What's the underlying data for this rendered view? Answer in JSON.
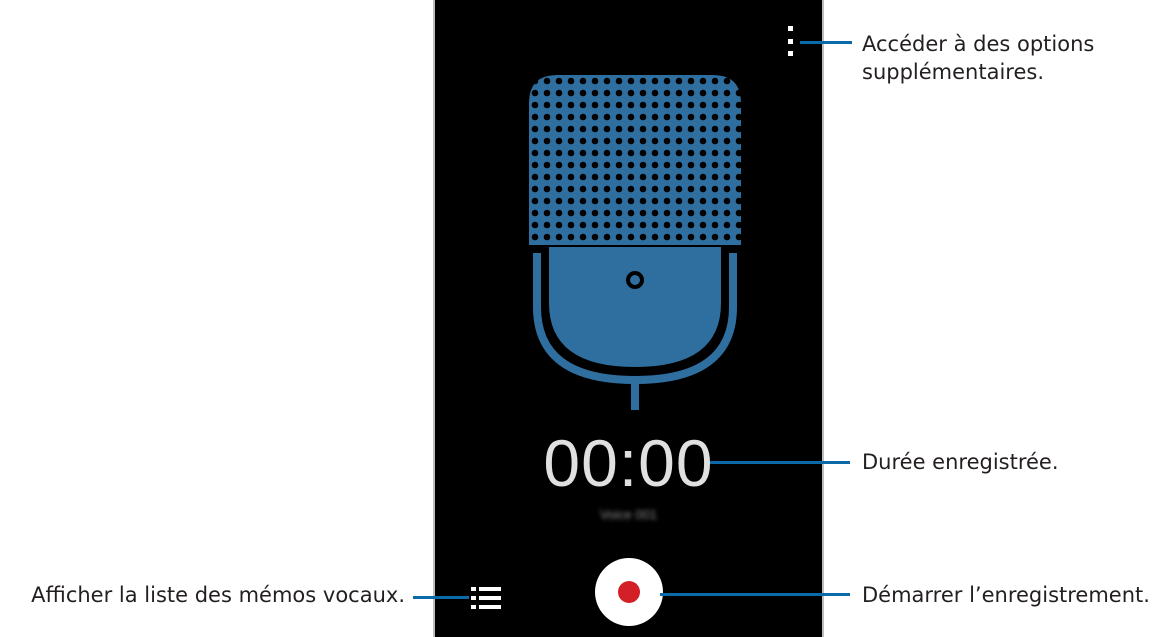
{
  "screen": {
    "timer": "00:00",
    "recording_name": "Voice 001"
  },
  "icons": {
    "overflow_menu": "more-vertical-icon",
    "list": "list-icon",
    "record": "record-icon",
    "microphone": "microphone-icon"
  },
  "colors": {
    "background": "#000000",
    "microphone": "#2f6fa0",
    "record_dot": "#d32027",
    "leader_line": "#0d6aa8"
  },
  "callouts": {
    "more_options_line1": "Accéder à des options",
    "more_options_line2": "supplémentaires.",
    "recorded_duration": "Durée enregistrée.",
    "start_recording": "Démarrer l’enregistrement.",
    "voice_memo_list": "Afficher la liste des mémos vocaux."
  }
}
